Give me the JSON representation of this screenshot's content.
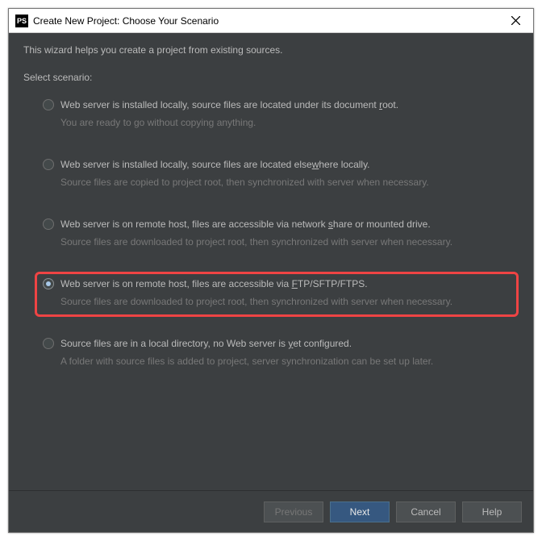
{
  "window": {
    "logo_text": "PS",
    "title": "Create New Project: Choose Your Scenario"
  },
  "intro": "This wizard helps you create a project from existing sources.",
  "select_label": "Select scenario:",
  "options": [
    {
      "label_pre": "Web server is installed locally, source files are located under its document ",
      "label_u": "r",
      "label_post": "oot.",
      "desc": "You are ready to go without copying anything.",
      "selected": false,
      "highlight": false
    },
    {
      "label_pre": "Web server is installed locally, source files are located else",
      "label_u": "w",
      "label_post": "here locally.",
      "desc": "Source files are copied to project root, then synchronized with server when necessary.",
      "selected": false,
      "highlight": false
    },
    {
      "label_pre": "Web server is on remote host, files are accessible via network ",
      "label_u": "s",
      "label_post": "hare or mounted drive.",
      "desc": "Source files are downloaded to project root, then synchronized with server when necessary.",
      "selected": false,
      "highlight": false
    },
    {
      "label_pre": "Web server is on remote host, files are accessible via ",
      "label_u": "F",
      "label_post": "TP/SFTP/FTPS.",
      "desc": "Source files are downloaded to project root, then synchronized with server when necessary.",
      "selected": true,
      "highlight": true
    },
    {
      "label_pre": "Source files are in a local directory, no Web server is ",
      "label_u": "y",
      "label_post": "et configured.",
      "desc": "A folder with source files is added to project, server synchronization can be set up later.",
      "selected": false,
      "highlight": false
    }
  ],
  "buttons": {
    "previous": "Previous",
    "next": "Next",
    "cancel": "Cancel",
    "help": "Help"
  }
}
